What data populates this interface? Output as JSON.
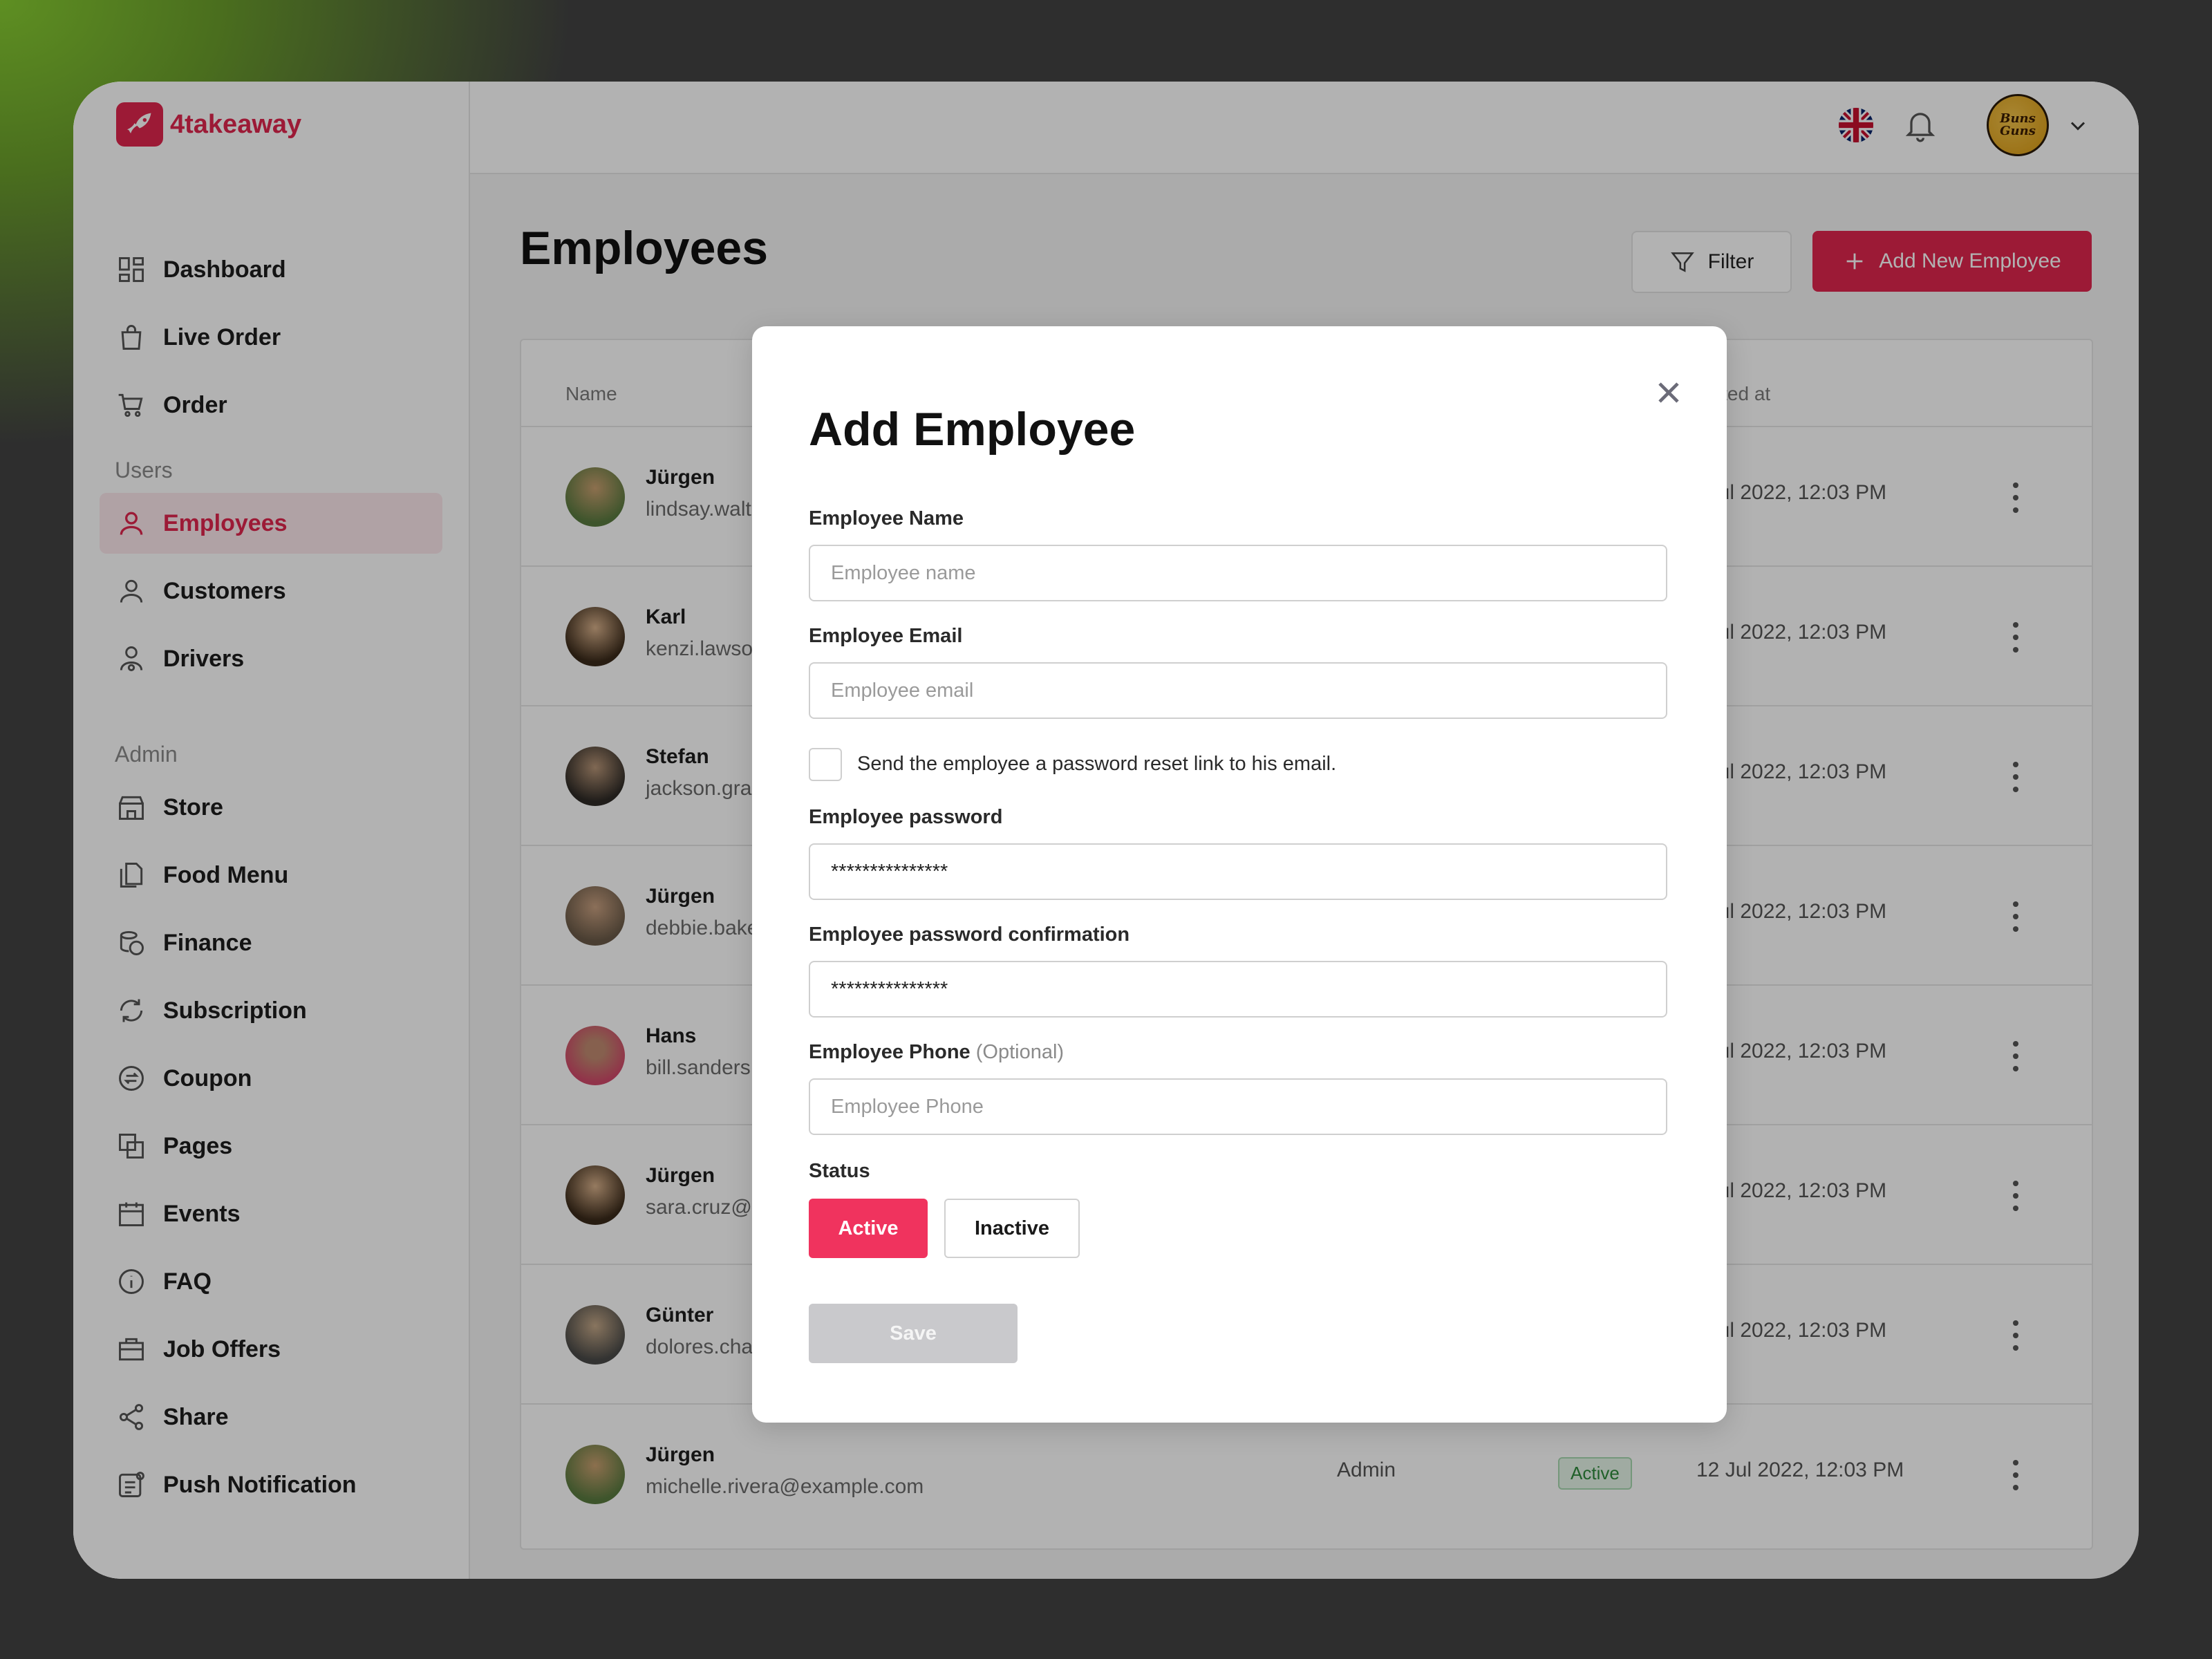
{
  "app": {
    "brand": "4takeaway",
    "brand_color": "#e0264e"
  },
  "sidebar": {
    "items_top": [
      {
        "label": "Dashboard",
        "icon": "dashboard-icon"
      },
      {
        "label": "Live Order",
        "icon": "bag-icon"
      },
      {
        "label": "Order",
        "icon": "cart-icon"
      }
    ],
    "users_label": "Users",
    "items_users": [
      {
        "label": "Employees",
        "icon": "user-icon",
        "active": true
      },
      {
        "label": "Customers",
        "icon": "user-icon"
      },
      {
        "label": "Drivers",
        "icon": "driver-icon"
      }
    ],
    "admin_label": "Admin",
    "items_admin": [
      {
        "label": "Store",
        "icon": "store-icon"
      },
      {
        "label": "Food Menu",
        "icon": "document-icon"
      },
      {
        "label": "Finance",
        "icon": "coins-icon"
      },
      {
        "label": "Subscription",
        "icon": "refresh-icon"
      },
      {
        "label": "Coupon",
        "icon": "coupon-icon"
      },
      {
        "label": "Pages",
        "icon": "pages-icon"
      },
      {
        "label": "Events",
        "icon": "calendar-icon"
      },
      {
        "label": "FAQ",
        "icon": "info-icon"
      },
      {
        "label": "Job Offers",
        "icon": "briefcase-icon"
      },
      {
        "label": "Share",
        "icon": "share-icon"
      },
      {
        "label": "Push Notification",
        "icon": "notification-icon"
      }
    ]
  },
  "topbar": {
    "avatar_text": "Buns Guns"
  },
  "main": {
    "title": "Employees",
    "filter_label": "Filter",
    "add_label": "Add New Employee",
    "columns": {
      "name": "Name",
      "created": "eated at"
    },
    "rows": [
      {
        "name": "Jürgen",
        "email": "lindsay.walt",
        "date": ": Jul 2022, 12:03 PM"
      },
      {
        "name": "Karl",
        "email": "kenzi.lawso",
        "date": ": Jul 2022, 12:03 PM"
      },
      {
        "name": "Stefan",
        "email": "jackson.gra",
        "date": ": Jul 2022, 12:03 PM"
      },
      {
        "name": "Jürgen",
        "email": "debbie.bake",
        "date": ": Jul 2022, 12:03 PM"
      },
      {
        "name": "Hans",
        "email": "bill.sanders",
        "date": ": Jul 2022, 12:03 PM"
      },
      {
        "name": "Jürgen",
        "email": "sara.cruz@",
        "date": ": Jul 2022, 12:03 PM"
      },
      {
        "name": "Günter",
        "email": "dolores.cha",
        "date": ": Jul 2022, 12:03 PM"
      },
      {
        "name": "Jürgen",
        "email": "michelle.rivera@example.com",
        "role": "Admin",
        "status": "Active",
        "date": "12 Jul 2022, 12:03 PM"
      }
    ]
  },
  "modal": {
    "title": "Add Employee",
    "name_label": "Employee Name",
    "name_placeholder": "Employee name",
    "email_label": "Employee Email",
    "email_placeholder": "Employee email",
    "reset_checkbox_label": "Send the employee a password reset link to his email.",
    "password_label": "Employee password",
    "password_value": "***************",
    "password_confirm_label": "Employee password confirmation",
    "password_confirm_value": "***************",
    "phone_label": "Employee Phone",
    "phone_optional": "(Optional)",
    "phone_placeholder": "Employee Phone",
    "status_label": "Status",
    "status_active": "Active",
    "status_inactive": "Inactive",
    "save_label": "Save"
  }
}
